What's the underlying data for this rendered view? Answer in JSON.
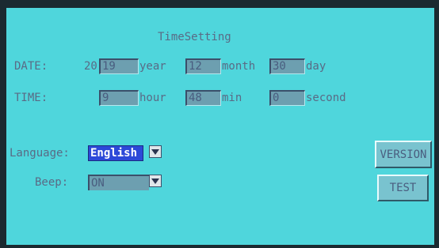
{
  "title": "TimeSetting",
  "date": {
    "label": "DATE:",
    "year_prefix": "20",
    "year_value": "19",
    "year_unit": "year",
    "month_value": "12",
    "month_unit": "month",
    "day_value": "30",
    "day_unit": "day"
  },
  "time": {
    "label": "TIME:",
    "hour_value": "9",
    "hour_unit": "hour",
    "min_value": "48",
    "min_unit": "min",
    "second_value": "0",
    "second_unit": "second"
  },
  "language": {
    "label": "Language:",
    "value": "English"
  },
  "beep": {
    "label": "Beep:",
    "value": "ON"
  },
  "buttons": {
    "version": "VERSION",
    "test": "TEST"
  },
  "colors": {
    "screen": "#4fd6dc",
    "selected": "#2c49d8",
    "text": "#5a6a85"
  },
  "icons": {
    "dropdown": "chevron-down-icon"
  }
}
